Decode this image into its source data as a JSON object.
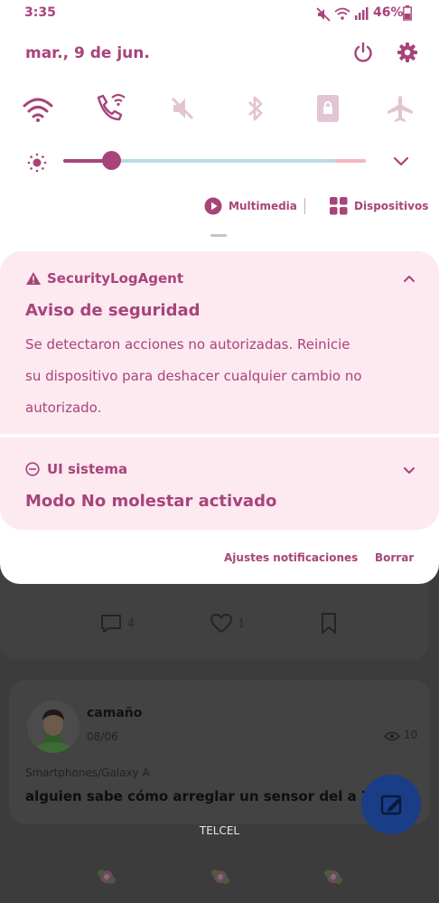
{
  "colors": {
    "accent": "#a8447a",
    "notification_bg": "#fde9f0",
    "slider_mid": "#b9dbe6",
    "slider_end": "#f3b8c0",
    "fab": "#1a3d88"
  },
  "status_bar": {
    "time": "3:35",
    "battery": "46%",
    "icons": [
      "mute-icon",
      "wifi-icon",
      "signal-icon",
      "battery-icon"
    ]
  },
  "panel": {
    "date": "mar., 9 de jun.",
    "quick_settings": [
      "wifi-icon",
      "wifi-calling-icon",
      "sound-off-icon",
      "bluetooth-icon",
      "portrait-lock-icon",
      "airplane-icon"
    ],
    "brightness_level": 0.17,
    "media_label": "Multimedia",
    "devices_label": "Dispositivos"
  },
  "notifications": [
    {
      "app": "SecurityLogAgent",
      "title": "Aviso de seguridad",
      "lines": [
        "Se detectaron acciones no autorizadas. Reinicie",
        "su dispositivo para deshacer cualquier cambio no",
        "autorizado."
      ]
    },
    {
      "app": "UI sistema",
      "title": "Modo No molestar activado"
    }
  ],
  "footer": {
    "settings_label": "Ajustes notificaciones",
    "clear_label": "Borrar"
  },
  "background_app": {
    "comments": "4",
    "likes": "1",
    "post": {
      "user": "camaño",
      "date": "08/06",
      "views": "10",
      "category": "Smartphones/Galaxy A",
      "title": "alguien sabe cómo arreglar un sensor del a 71"
    },
    "carrier": "TELCEL"
  }
}
